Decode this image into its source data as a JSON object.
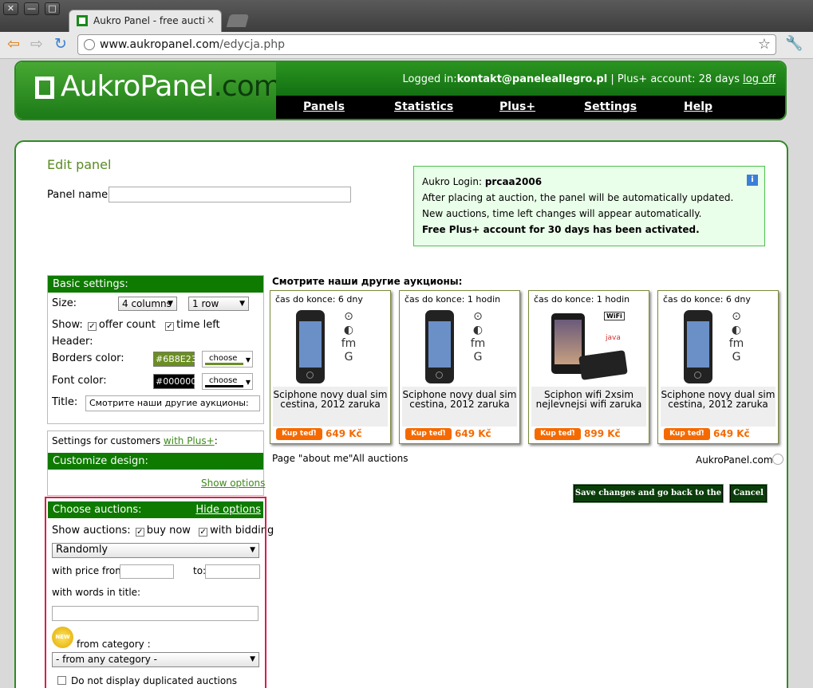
{
  "browser": {
    "tab_title": "Aukro Panel - free auction",
    "tab_close": "×",
    "url_domain": "www.aukropanel.com",
    "url_path": "/edycja.php",
    "back_glyph": "⇦",
    "forward_glyph": "⇨",
    "reload_glyph": "↻",
    "star_glyph": "☆",
    "wrench_glyph": "🔧",
    "win_close": "✕",
    "win_min": "—",
    "win_max": "□"
  },
  "header": {
    "logo_main": "AukroPanel",
    "logo_suffix": ".com",
    "logged_in_label": "Logged in:",
    "user_email": "kontakt@paneleallegro.pl",
    "account_info": " | Plus+ account: 28 days ",
    "logout": "log off",
    "menu": [
      "Panels",
      "Statistics",
      "Plus+",
      "Settings",
      "Help"
    ]
  },
  "edit": {
    "title": "Edit panel",
    "panel_name_label": "Panel name:",
    "panel_name_value": ""
  },
  "info": {
    "login_label": "Aukro Login: ",
    "login_value": "prcaa2006",
    "line1": "After placing at auction, the panel will be automatically updated. New auctions, time left changes will appear automatically.",
    "line2": "Free Plus+ account for 30 days has been activated.",
    "icon": "i"
  },
  "basic": {
    "header": "Basic settings:",
    "size_label": "Size:",
    "columns": "4 columns",
    "rows": "1 row",
    "show_label": "Show:",
    "offer_count": "offer count",
    "time_left": "time left",
    "header_label": "Header:",
    "borders_color_label": "Borders color:",
    "borders_color": "#6B8E23",
    "font_color_label": "Font color:",
    "font_color": "#000000",
    "choose": "choose",
    "title_label": "Title:",
    "title_value": "Смотрите наши другие аукционы:",
    "check": "✓",
    "arrow": "▼"
  },
  "customize": {
    "settings_text": "Settings for customers ",
    "with_plus": "with Plus+",
    "colon": ":",
    "header": "Customize design:",
    "show_options": "Show options"
  },
  "choose": {
    "header": "Choose auctions:",
    "hide_options": "Hide options",
    "show_auctions_label": "Show auctions:",
    "buy_now": "buy now",
    "with_bidding": "with bidding",
    "order": "Randomly",
    "price_label": "with price",
    "from_label": "from:",
    "to_label": "to:",
    "words_label": "with words in title:",
    "new_badge": "NEW",
    "category_label": "from category :",
    "category_value": "- from any category -",
    "no_duplicates": "Do not display duplicated auctions"
  },
  "auctions": {
    "title": "Смотрите наши другие аукционы:",
    "buy_label": "Kup teď!",
    "items": [
      {
        "time": "čas do konce: 6 dny",
        "name": "Sciphone novy dual sim cestina, 2012 zaruka",
        "price": "649 Kč"
      },
      {
        "time": "čas do konce: 1 hodin",
        "name": "Sciphone novy dual sim cestina, 2012 zaruka",
        "price": "649 Kč"
      },
      {
        "time": "čas do konce: 1 hodin",
        "name": "Sciphon wifi 2xsim nejlevnejsi wifi zaruka",
        "price": "899 Kč"
      },
      {
        "time": "čas do konce: 6 dny",
        "name": "Sciphone novy dual sim cestina, 2012 zaruka",
        "price": "649 Kč"
      }
    ],
    "about_me": "Page \"about me\"",
    "all_auctions": "All auctions",
    "brand": "AukroPanel.com",
    "icon_glyphs": [
      "⊙",
      "◐",
      "fm",
      "G"
    ],
    "wifi_text": "WiFi",
    "java_text": "java"
  },
  "actions": {
    "save": "Save changes and go back to the list",
    "cancel": "Cancel"
  }
}
